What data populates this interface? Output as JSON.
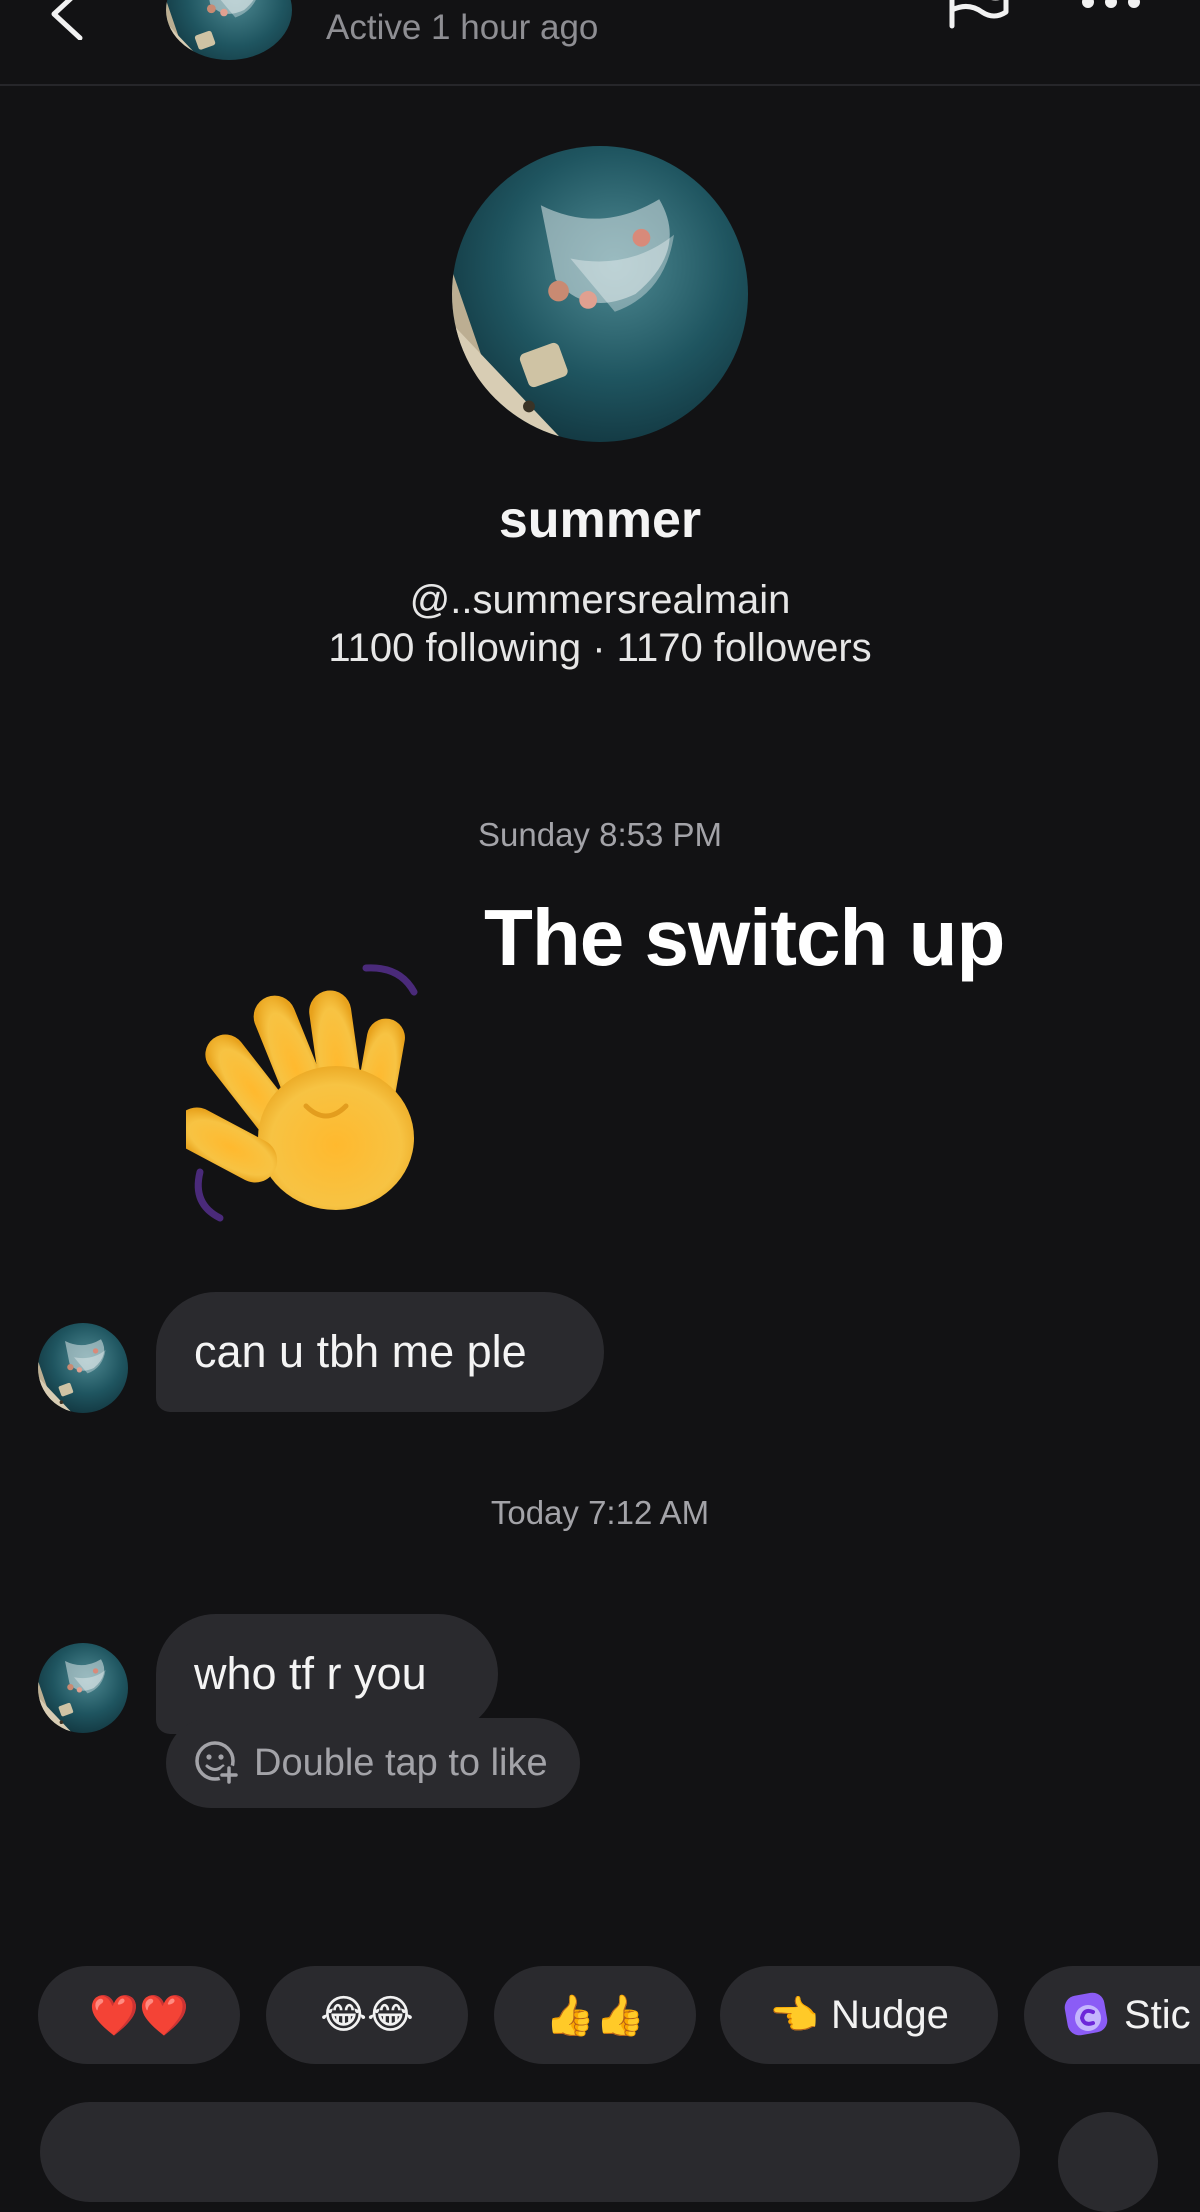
{
  "header": {
    "status": "Active 1 hour ago",
    "back_icon": "chevron-left-icon",
    "flag_icon": "flag-icon",
    "more_icon": "more-horizontal-icon"
  },
  "profile": {
    "name": "summer",
    "handle": "@..summersrealmain",
    "stats": "1100 following · 1170 followers"
  },
  "conversation": {
    "timestamp_1": "Sunday 8:53 PM",
    "sticker": {
      "caption": "The switch up",
      "icon": "waving-hand-icon"
    },
    "message_1": "can u tbh me ple",
    "timestamp_2": "Today 7:12 AM",
    "message_2": "who tf r you",
    "like_hint": "Double tap to like",
    "like_hint_icon": "add-reaction-icon"
  },
  "quick_reactions": {
    "hearts": "❤️❤️",
    "laughing": "😂😂",
    "thumbs_up": "👍👍",
    "nudge_emoji": "👈",
    "nudge_label": "Nudge",
    "sticker_label": "Stic",
    "sticker_icon": "sticker-icon"
  },
  "colors": {
    "background": "#121214",
    "bubble": "#2a2a2e",
    "secondary_text": "#a3a3a8"
  }
}
